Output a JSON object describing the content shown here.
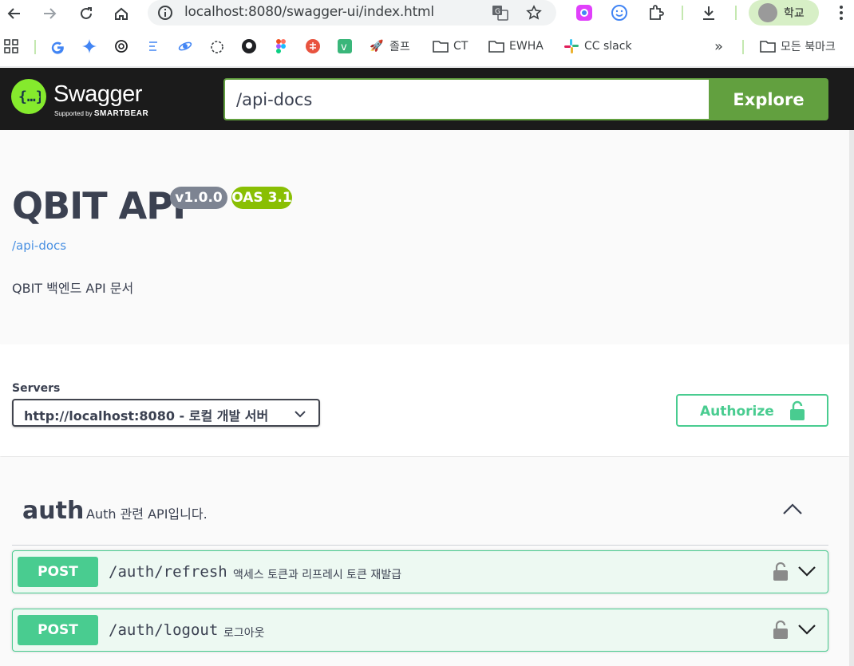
{
  "browser": {
    "url": "localhost:8080/swagger-ui/index.html",
    "profile_label": "학교",
    "bookmarks": [
      {
        "label": "졸프",
        "icon": "rocket-icon"
      },
      {
        "label": "CT",
        "icon": "folder-icon"
      },
      {
        "label": "EWHA",
        "icon": "folder-icon"
      },
      {
        "label": "CC slack",
        "icon": "slack-icon"
      }
    ],
    "all_bookmarks_label": "모든 북마크",
    "overflow_label": "»"
  },
  "topbar": {
    "brand": "Swagger",
    "supported_by": "Supported by",
    "smartbear": "SMARTBEAR",
    "spec_url_value": "/api-docs",
    "explore_label": "Explore"
  },
  "info": {
    "title": "QBIT API",
    "version_badge": "v1.0.0",
    "oas_badge": "OAS 3.1",
    "spec_link": "/api-docs",
    "description": "QBIT 백엔드 API 문서"
  },
  "servers": {
    "label": "Servers",
    "selected": "http://localhost:8080 - 로컬 개발 서버"
  },
  "authorize": {
    "label": "Authorize"
  },
  "tag": {
    "name": "auth",
    "description": "Auth 관련 API입니다."
  },
  "operations": [
    {
      "method": "POST",
      "path": "/auth/refresh",
      "summary": "액세스 토큰과 리프레시 토큰 재발급"
    },
    {
      "method": "POST",
      "path": "/auth/logout",
      "summary": "로그아웃"
    }
  ],
  "colors": {
    "post": "#49cc90",
    "post_bg": "#edf9f2",
    "swagger_green": "#85ea2d",
    "explore": "#62a03f",
    "version_badge": "#7d8492",
    "oas_badge": "#89bf04",
    "link": "#4990e2"
  }
}
